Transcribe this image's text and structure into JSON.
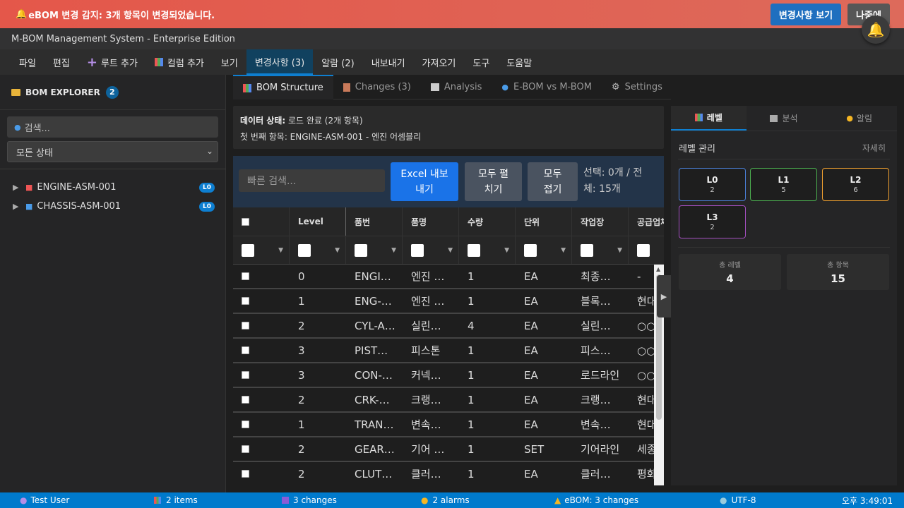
{
  "banner": {
    "icon": "bell-icon",
    "prefix": "eBOM 변경 감지:",
    "message": " 3개 항목이 변경되었습니다.",
    "view_button": "변경사항 보기",
    "later_button": "나중에"
  },
  "app_title": "M-BOM Management System - Enterprise Edition",
  "menu": [
    {
      "label": "파일"
    },
    {
      "label": "편집"
    },
    {
      "label": "루트 추가",
      "icon": "plus-icon"
    },
    {
      "label": "컬럼 추가",
      "icon": "chart-icon"
    },
    {
      "label": "보기"
    },
    {
      "label": "변경사항 (3)",
      "active": true
    },
    {
      "label": "알람 (2)"
    },
    {
      "label": "내보내기"
    },
    {
      "label": "가져오기"
    },
    {
      "label": "도구"
    },
    {
      "label": "도움말"
    }
  ],
  "sidebar": {
    "title": "BOM EXPLORER",
    "count": "2",
    "search_placeholder": "검색...",
    "status_select": "모든 상태",
    "items": [
      {
        "label": "ENGINE-ASM-001",
        "level": "L0",
        "icon": "car-icon"
      },
      {
        "label": "CHASSIS-ASM-001",
        "level": "L0",
        "icon": "car-icon"
      }
    ]
  },
  "tabs": [
    {
      "label": "BOM Structure",
      "icon": "chart-icon",
      "active": true
    },
    {
      "label": "Changes (3)",
      "icon": "document-icon"
    },
    {
      "label": "Analysis",
      "icon": "line-chart-icon"
    },
    {
      "label": "E-BOM vs M-BOM",
      "icon": "search-icon"
    },
    {
      "label": "Settings",
      "icon": "gear-icon"
    }
  ],
  "data_status": {
    "label": "데이터 상태:",
    "value": "로드 완료 (2개 항목)",
    "first_item": "첫 번째 항목: ENGINE-ASM-001 - 엔진 어셈블리"
  },
  "toolbar": {
    "quick_search_placeholder": "빠른 검색...",
    "excel_line1": "Excel 내보",
    "excel_line2": "내기",
    "expand_line1": "모두 펼",
    "expand_line2": "치기",
    "collapse_line1": "모두",
    "collapse_line2": "접기",
    "selection_line1": "선택: 0개 / 전",
    "selection_line2": "체: 15개"
  },
  "grid": {
    "columns": [
      "Level",
      "품번",
      "품명",
      "수량",
      "단위",
      "작업장",
      "공급업체"
    ],
    "rows": [
      [
        "0",
        "ENGI…",
        "엔진 …",
        "1",
        "EA",
        "최종…",
        "-"
      ],
      [
        "1",
        "ENG-…",
        "엔진 …",
        "1",
        "EA",
        "블록…",
        "현대"
      ],
      [
        "2",
        "CYL-A…",
        "실린…",
        "4",
        "EA",
        "실린…",
        "○○"
      ],
      [
        "3",
        "PIST…",
        "피스톤",
        "1",
        "EA",
        "피스…",
        "○○"
      ],
      [
        "3",
        "CON-…",
        "커넥…",
        "1",
        "EA",
        "로드라인",
        "○○"
      ],
      [
        "2",
        "CRK-…",
        "크랭…",
        "1",
        "EA",
        "크랭…",
        "현대"
      ],
      [
        "1",
        "TRAN…",
        "변속…",
        "1",
        "EA",
        "변속…",
        "현대"
      ],
      [
        "2",
        "GEAR…",
        "기어 …",
        "1",
        "SET",
        "기어라인",
        "세종"
      ],
      [
        "2",
        "CLUT…",
        "클러…",
        "1",
        "EA",
        "클러…",
        "평화"
      ]
    ]
  },
  "right_panel": {
    "tabs": [
      {
        "label": "레벨",
        "icon": "chart-icon",
        "active": true
      },
      {
        "label": "분석",
        "icon": "line-chart-icon"
      },
      {
        "label": "알림",
        "icon": "bell-icon"
      }
    ],
    "title": "레벨 관리",
    "more": "자세히",
    "levels": [
      {
        "label": "L0",
        "count": "2",
        "color": "#4a7fd6"
      },
      {
        "label": "L1",
        "count": "5",
        "color": "#4caf50"
      },
      {
        "label": "L2",
        "count": "6",
        "color": "#f0a030"
      },
      {
        "label": "L3",
        "count": "2",
        "color": "#a44fc0"
      }
    ],
    "total_levels_label": "총 레벨",
    "total_levels": "4",
    "total_items_label": "총 항목",
    "total_items": "15"
  },
  "statusbar": {
    "user": "Test User",
    "items": "2 items",
    "changes": "3 changes",
    "alarms": "2 alarms",
    "ebom": "eBOM: 3 changes",
    "encoding": "UTF-8",
    "time": "오후 3:49:01"
  }
}
